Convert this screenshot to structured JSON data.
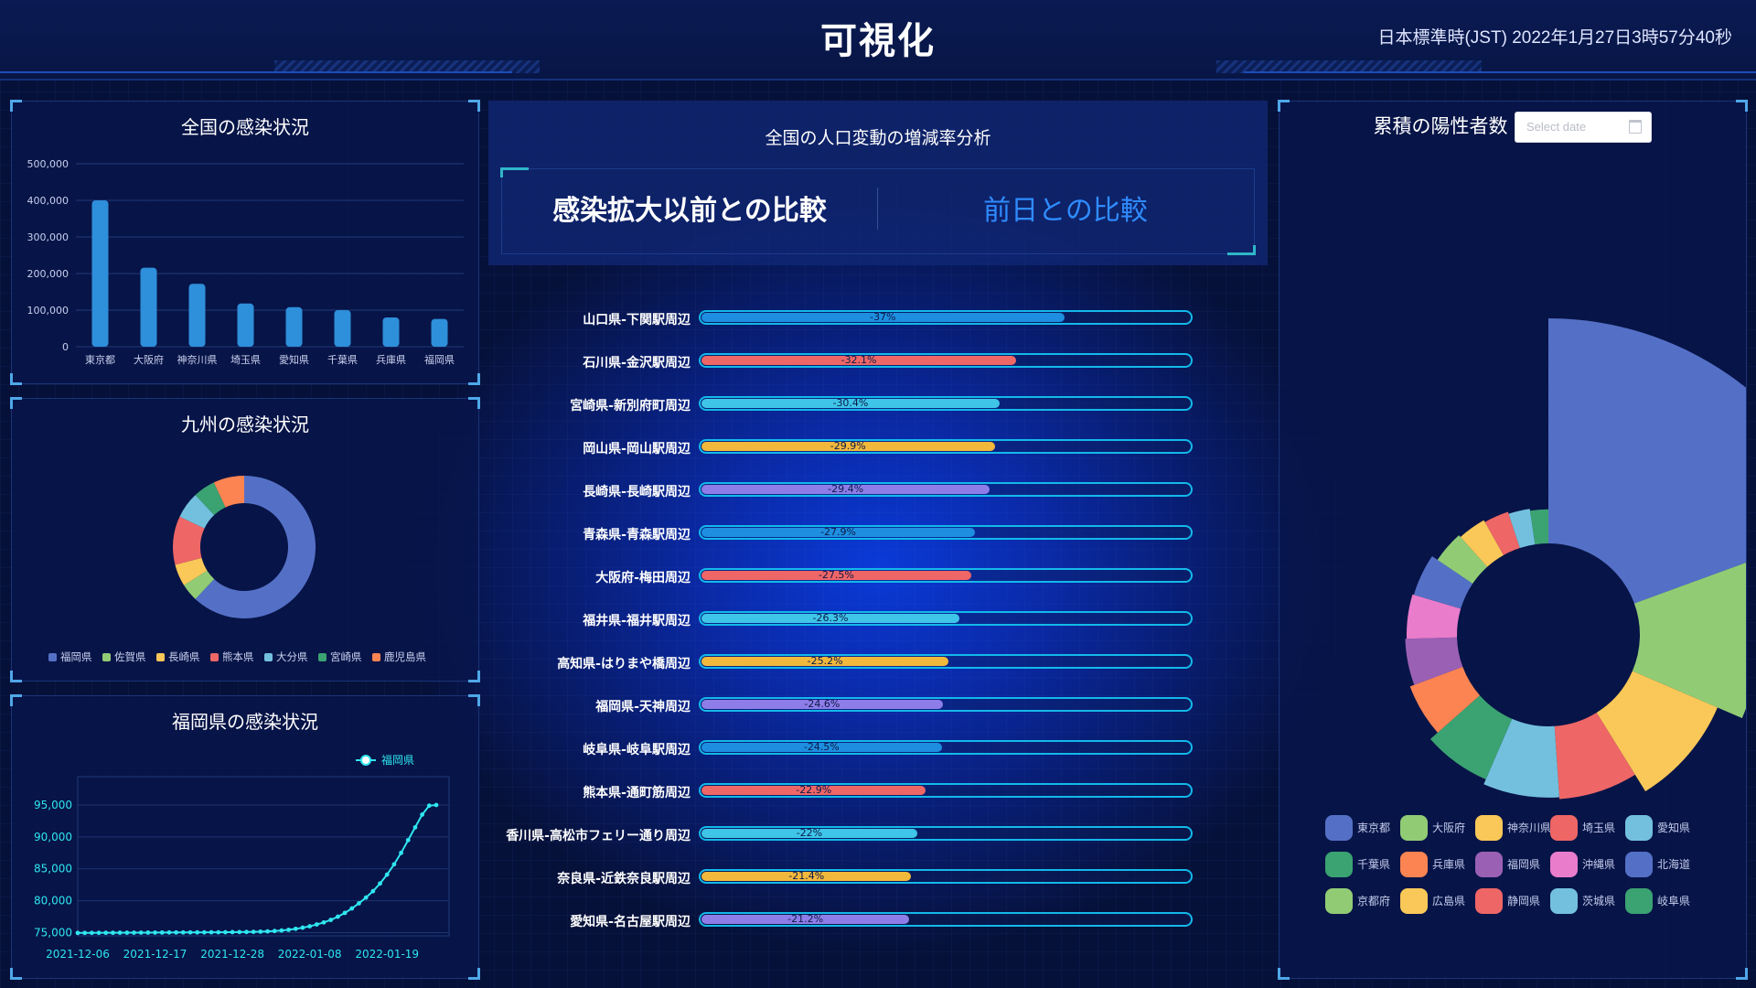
{
  "header": {
    "title": "可視化",
    "clock": "日本標準時(JST) 2022年1月27日3時57分40秒"
  },
  "national_chart": {
    "title": "全国の感染状況",
    "chart_data": {
      "type": "bar",
      "categories": [
        "東京都",
        "大阪府",
        "神奈川県",
        "埼玉県",
        "愛知県",
        "千葉県",
        "兵庫県",
        "福岡県"
      ],
      "values": [
        400000,
        216000,
        172000,
        118000,
        108000,
        100000,
        80000,
        76000
      ],
      "ylim": [
        0,
        500000
      ],
      "yticks": [
        "0",
        "100,000",
        "200,000",
        "300,000",
        "400,000",
        "500,000"
      ],
      "color": "#2e8fda"
    }
  },
  "kyushu_chart": {
    "title": "九州の感染状況",
    "chart_data": {
      "type": "pie",
      "categories": [
        "福岡県",
        "佐賀県",
        "長崎県",
        "熊本県",
        "大分県",
        "宮崎県",
        "鹿児島県"
      ],
      "values": [
        62,
        4,
        5,
        11,
        6,
        5,
        7
      ],
      "colors": [
        "#5470c6",
        "#91cc75",
        "#fac858",
        "#ee6666",
        "#73c0de",
        "#3ba272",
        "#fc8452"
      ]
    }
  },
  "fukuoka_chart": {
    "title": "福岡県の感染状況",
    "legend": "福岡県",
    "chart_data": {
      "type": "line",
      "x_ticks": [
        "2021-12-06",
        "2021-12-17",
        "2021-12-28",
        "2022-01-08",
        "2022-01-19"
      ],
      "y_ticks": [
        "75,000",
        "80,000",
        "85,000",
        "90,000",
        "95,000"
      ],
      "ylim": [
        74500,
        96000
      ],
      "x": [
        "2021-12-06",
        "2021-12-07",
        "2021-12-08",
        "2021-12-09",
        "2021-12-10",
        "2021-12-11",
        "2021-12-12",
        "2021-12-13",
        "2021-12-14",
        "2021-12-15",
        "2021-12-16",
        "2021-12-17",
        "2021-12-18",
        "2021-12-19",
        "2021-12-20",
        "2021-12-21",
        "2021-12-22",
        "2021-12-23",
        "2021-12-24",
        "2021-12-25",
        "2021-12-26",
        "2021-12-27",
        "2021-12-28",
        "2021-12-29",
        "2021-12-30",
        "2021-12-31",
        "2022-01-01",
        "2022-01-02",
        "2022-01-03",
        "2022-01-04",
        "2022-01-05",
        "2022-01-06",
        "2022-01-07",
        "2022-01-08",
        "2022-01-09",
        "2022-01-10",
        "2022-01-11",
        "2022-01-12",
        "2022-01-13",
        "2022-01-14",
        "2022-01-15",
        "2022-01-16",
        "2022-01-17",
        "2022-01-18",
        "2022-01-19",
        "2022-01-20",
        "2022-01-21",
        "2022-01-22",
        "2022-01-23",
        "2022-01-24",
        "2022-01-25",
        "2022-01-26"
      ],
      "values": [
        74960,
        74965,
        74970,
        74975,
        74980,
        74985,
        74990,
        74995,
        75000,
        75005,
        75010,
        75015,
        75020,
        75025,
        75030,
        75035,
        75040,
        75045,
        75050,
        75055,
        75060,
        75070,
        75080,
        75095,
        75110,
        75130,
        75160,
        75200,
        75260,
        75340,
        75450,
        75600,
        75780,
        76000,
        76280,
        76600,
        77000,
        77500,
        78100,
        78800,
        79600,
        80500,
        81500,
        82700,
        84100,
        85700,
        87500,
        89500,
        91500,
        93500,
        94900,
        95000
      ],
      "color": "#2fe6f0"
    }
  },
  "center": {
    "title": "全国の人口変動の増減率分析",
    "tab_left": "感染拡大以前との比較",
    "tab_right": "前日との比較",
    "chart_data": {
      "type": "bar",
      "categories": [
        "山口県-下関駅周辺",
        "石川県-金沢駅周辺",
        "宮崎県-新別府町周辺",
        "岡山県-岡山駅周辺",
        "長崎県-長崎駅周辺",
        "青森県-青森駅周辺",
        "大阪府-梅田周辺",
        "福井県-福井駅周辺",
        "高知県-はりまや橋周辺",
        "福岡県-天神周辺",
        "岐阜県-岐阜駅周辺",
        "熊本県-通町筋周辺",
        "香川県-高松市フェリー通り周辺",
        "奈良県-近鉄奈良駅周辺",
        "愛知県-名古屋駅周辺"
      ],
      "values": [
        -37,
        -32.1,
        -30.4,
        -29.9,
        -29.4,
        -27.9,
        -27.5,
        -26.3,
        -25.2,
        -24.6,
        -24.5,
        -22.9,
        -22,
        -21.4,
        -21.2
      ],
      "labels": [
        "-37%",
        "-32.1%",
        "-30.4%",
        "-29.9%",
        "-29.4%",
        "-27.9%",
        "-27.5%",
        "-26.3%",
        "-25.2%",
        "-24.6%",
        "-24.5%",
        "-22.9%",
        "-22%",
        "-21.4%",
        "-21.2%"
      ],
      "colors": [
        "#1e8fe0",
        "#ee6666",
        "#3fc5e8",
        "#f2b83c",
        "#8e7de8"
      ],
      "max": 50
    }
  },
  "cumulative_chart": {
    "title": "累積の陽性者数",
    "date_placeholder": "Select date",
    "chart_data": {
      "type": "pie",
      "rose": true,
      "categories": [
        "東京都",
        "大阪府",
        "神奈川県",
        "埼玉県",
        "愛知県",
        "千葉県",
        "兵庫県",
        "福岡県",
        "沖縄県",
        "北海道",
        "京都府",
        "広島県",
        "静岡県",
        "茨城県",
        "岐阜県"
      ],
      "values": [
        100,
        62,
        50,
        40,
        39,
        36,
        30,
        27,
        26,
        25,
        20,
        18,
        16,
        14,
        12
      ],
      "colors": [
        "#5470c6",
        "#91cc75",
        "#fac858",
        "#ee6666",
        "#73c0de",
        "#3ba272",
        "#fc8452",
        "#9a60b4",
        "#ea7ccc",
        "#5470c6",
        "#91cc75",
        "#fac858",
        "#ee6666",
        "#73c0de",
        "#3ba272"
      ]
    }
  }
}
